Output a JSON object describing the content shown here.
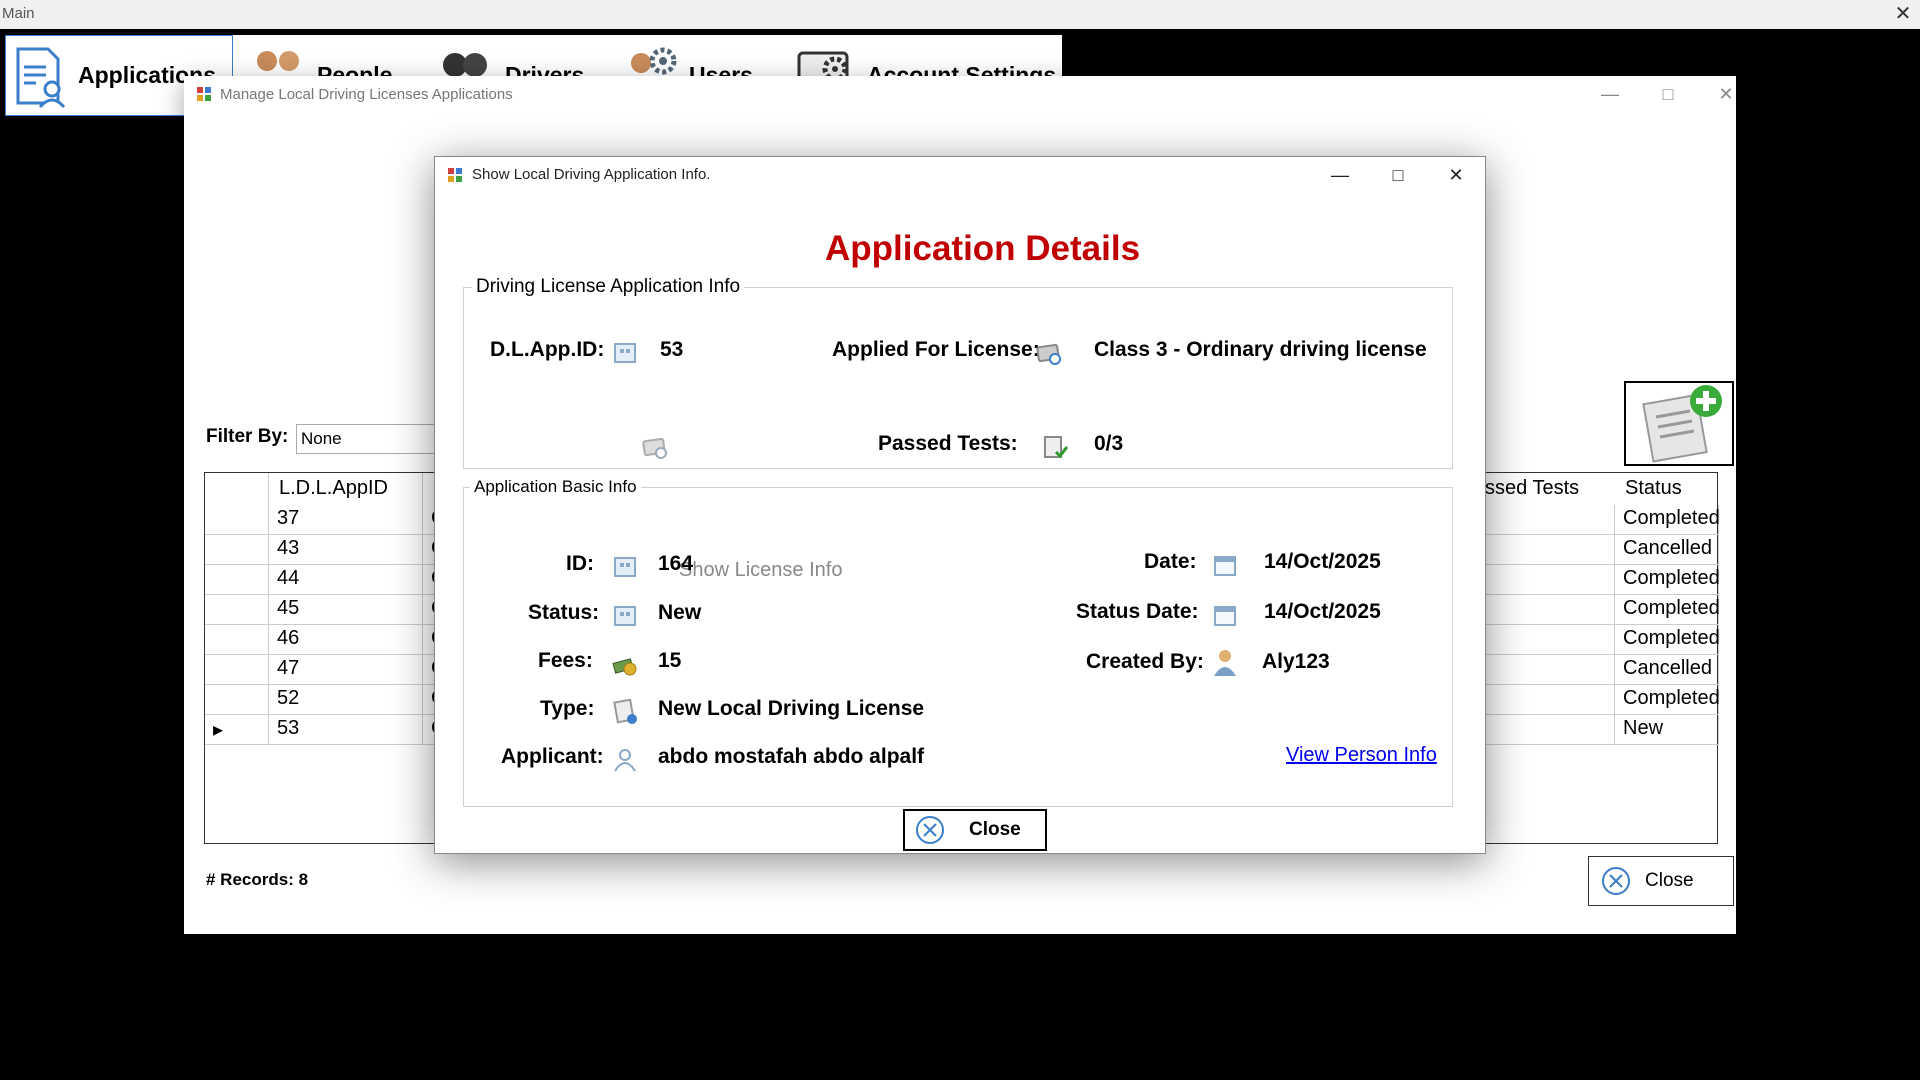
{
  "main_window": {
    "title": "Main",
    "close_glyph": "✕"
  },
  "toolbar": {
    "items": [
      {
        "label": "Applications",
        "icon": "applications-icon"
      },
      {
        "label": "People",
        "icon": "people-icon"
      },
      {
        "label": "Drivers",
        "icon": "drivers-icon"
      },
      {
        "label": "Users",
        "icon": "users-icon"
      },
      {
        "label": "Account Settings",
        "icon": "account-settings-icon"
      }
    ]
  },
  "manage_window": {
    "title": "Manage Local Driving Licenses Applications",
    "filter_label": "Filter By:",
    "filter_value": "None",
    "grid": {
      "columns": [
        "",
        "L.D.L.AppID",
        "",
        "ssed Tests",
        "Status"
      ],
      "rows": [
        {
          "marker": "",
          "id": "37",
          "class_prefix": "C",
          "status": "Completed"
        },
        {
          "marker": "",
          "id": "43",
          "class_prefix": "C",
          "status": "Cancelled"
        },
        {
          "marker": "",
          "id": "44",
          "class_prefix": "C",
          "status": "Completed"
        },
        {
          "marker": "",
          "id": "45",
          "class_prefix": "C",
          "status": "Completed"
        },
        {
          "marker": "",
          "id": "46",
          "class_prefix": "C",
          "status": "Completed"
        },
        {
          "marker": "",
          "id": "47",
          "class_prefix": "C",
          "status": "Cancelled"
        },
        {
          "marker": "",
          "id": "52",
          "class_prefix": "C",
          "status": "Completed"
        },
        {
          "marker": "▸",
          "id": "53",
          "class_prefix": "C",
          "status": "New"
        }
      ]
    },
    "records_label": "# Records: 8",
    "close_label": "Close"
  },
  "dialog": {
    "title": "Show Local Driving Application Info.",
    "heading": "Application Details",
    "license_group": {
      "legend": "Driving License Application Info",
      "dl_app_id_label": "D.L.App.ID:",
      "dl_app_id_value": "53",
      "applied_for_label": "Applied For License:",
      "applied_for_value": "Class 3 - Ordinary driving license",
      "show_license_info": "Show License Info",
      "passed_tests_label": "Passed Tests:",
      "passed_tests_value": "0/3"
    },
    "basic_group": {
      "legend": "Application Basic Info",
      "id_label": "ID:",
      "id_value": "164",
      "status_label": "Status:",
      "status_value": "New",
      "fees_label": "Fees:",
      "fees_value": "15",
      "type_label": "Type:",
      "type_value": "New Local Driving License",
      "applicant_label": "Applicant:",
      "applicant_value": "abdo mostafah abdo alpalf",
      "date_label": "Date:",
      "date_value": "14/Oct/2025",
      "status_date_label": "Status Date:",
      "status_date_value": "14/Oct/2025",
      "created_by_label": "Created By:",
      "created_by_value": "Aly123",
      "view_person_info": "View Person Info"
    },
    "close_label": "Close"
  },
  "colors": {
    "heading_red": "#c00000",
    "link_blue": "#0000ee",
    "accent_blue": "#3b7ecb"
  }
}
